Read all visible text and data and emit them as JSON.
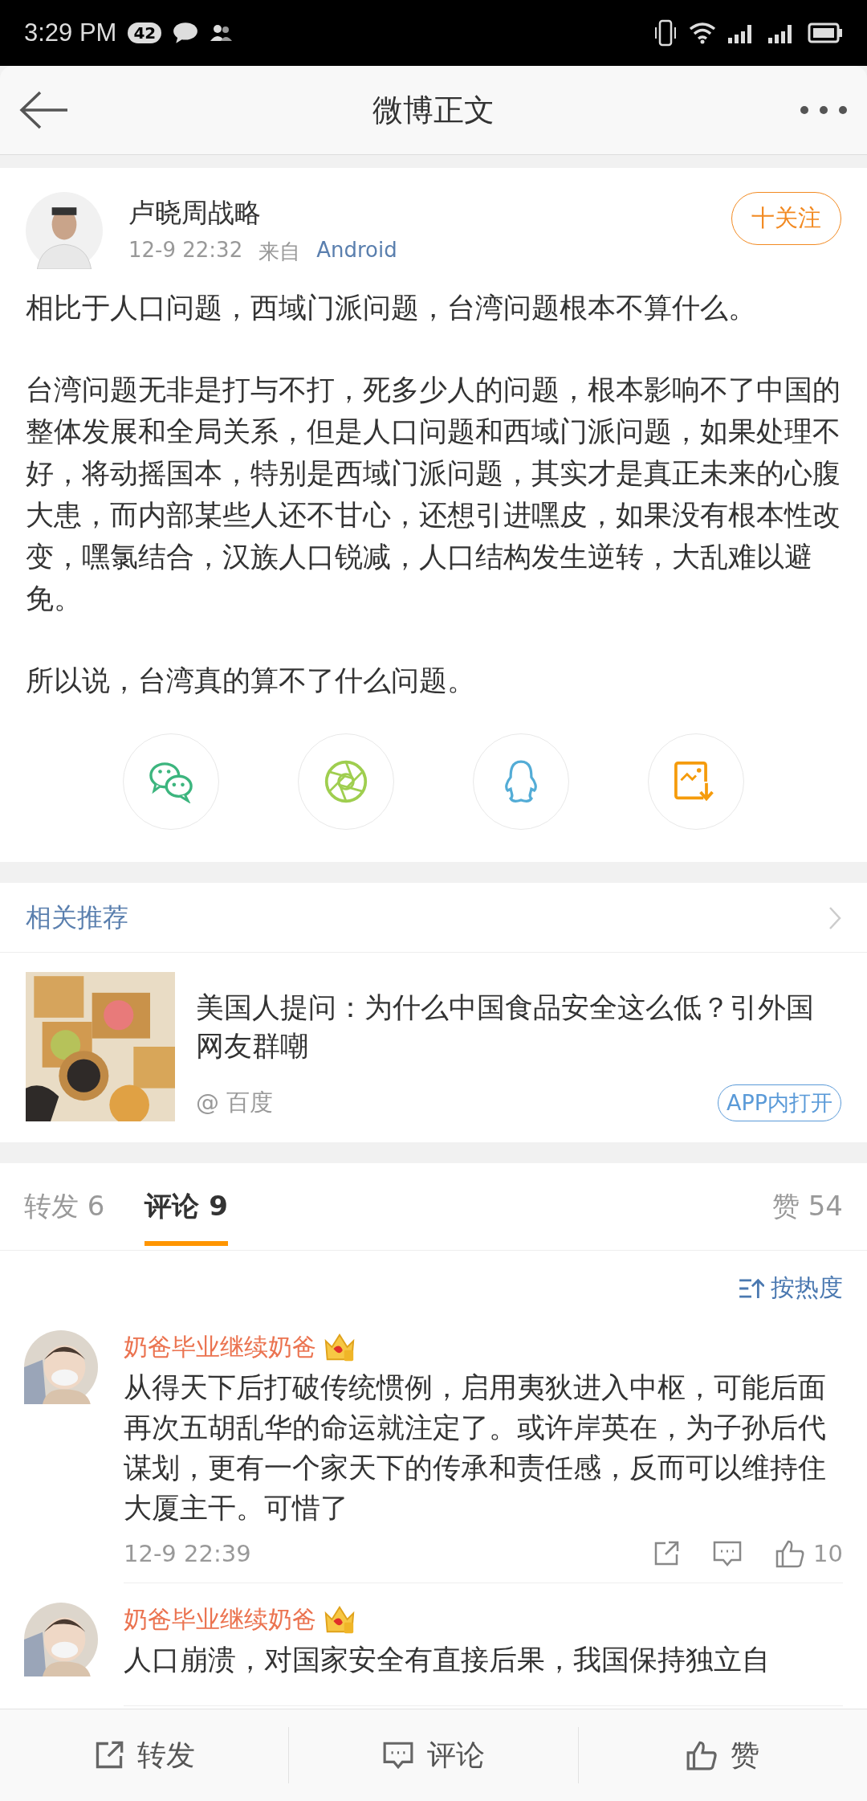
{
  "status_bar": {
    "time": "3:29 PM",
    "badge": "42"
  },
  "header": {
    "title": "微博正文"
  },
  "post": {
    "author": "卢晓周战略",
    "follow": "十关注",
    "time": "12-9 22:32",
    "source_prefix": "来自",
    "source": "Android",
    "paragraphs": [
      "相比于人口问题，西域门派问题，台湾问题根本不算什么。",
      "台湾问题无非是打与不打，死多少人的问题，根本影响不了中国的整体发展和全局关系，但是人口问题和西域门派问题，如果处理不好，将动摇国本，特别是西域门派问题，其实才是真正未来的心腹大患，而内部某些人还不甘心，还想引进嘿皮，如果没有根本性改变，嘿氯结合，汉族人口锐减，人口结构发生逆转，大乱难以避免。",
      "所以说，台湾真的算不了什么问题。"
    ]
  },
  "share_targets": [
    {
      "kind": "wechat"
    },
    {
      "kind": "moments"
    },
    {
      "kind": "qq"
    },
    {
      "kind": "save"
    }
  ],
  "related": {
    "title": "相关推荐",
    "item": {
      "headline": "美国人提问：为什么中国食品安全这么低？引外国网友群嘲",
      "source": "@ 百度",
      "open": "APP内打开"
    }
  },
  "tabs": [
    {
      "label": "转发 6",
      "selected": false
    },
    {
      "label": "评论 9",
      "selected": true
    }
  ],
  "likes_tab": "赞 54",
  "sort": "按热度",
  "comments": [
    {
      "author": "奶爸毕业继续奶爸",
      "text": "从得天下后打破传统惯例，启用夷狄进入中枢，可能后面再次五胡乱华的命运就注定了。或许岸英在，为子孙后代谋划，更有一个家天下的传承和责任感，反而可以维持住大厦主干。可惜了",
      "time": "12-9 22:39",
      "likes": "10"
    },
    {
      "author": "奶爸毕业继续奶爸",
      "text": "人口崩溃，对国家安全有直接后果，我国保持独立自"
    }
  ],
  "bottom_bar": [
    "转发",
    "评论",
    "赞"
  ]
}
